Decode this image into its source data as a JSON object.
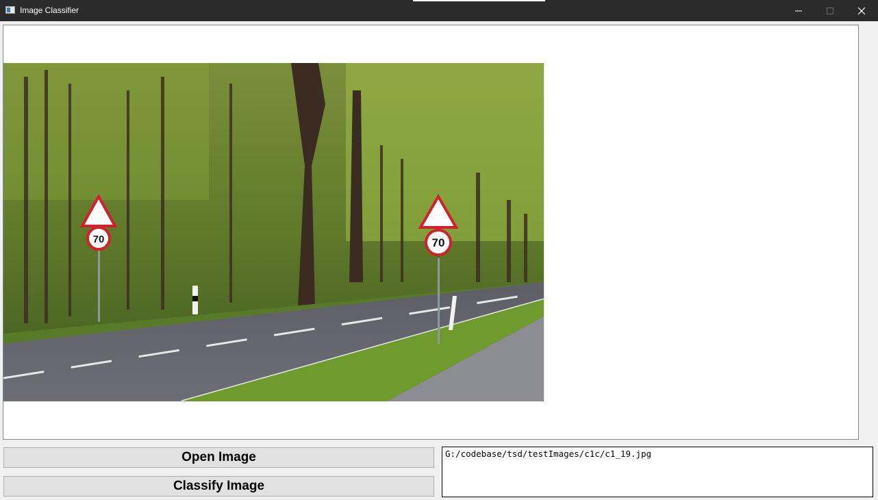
{
  "window": {
    "title": "Image Classifier",
    "icon": "app-window-icon",
    "controls": [
      "minimize-icon",
      "maximize-icon",
      "close-icon"
    ]
  },
  "image_view": {
    "description_icon": "road-photo",
    "sign_speed_label": "70"
  },
  "controls": {
    "open_label": "Open Image",
    "classify_label": "Classify Image"
  },
  "output": {
    "path": "G:/codebase/tsd/testImages/c1c/c1_19.jpg"
  },
  "colors": {
    "titlebar": "#2b2b2b",
    "button_bg": "#e1e1e1",
    "panel_border": "#828790"
  }
}
